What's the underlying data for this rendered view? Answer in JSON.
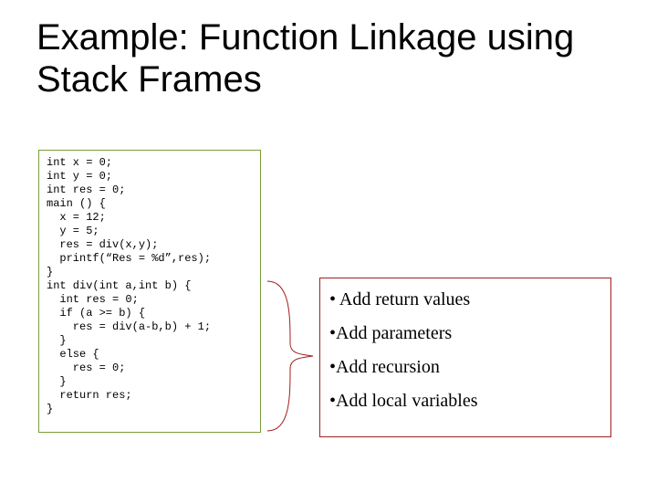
{
  "title": "Example: Function Linkage using Stack Frames",
  "code": "int x = 0;\nint y = 0;\nint res = 0;\nmain () {\n  x = 12;\n  y = 5;\n  res = div(x,y);\n  printf(“Res = %d”,res);\n}\nint div(int a,int b) {\n  int res = 0;\n  if (a >= b) {\n    res = div(a-b,b) + 1;\n  }\n  else {\n    res = 0;\n  }\n  return res;\n}",
  "bullets": {
    "b1": "• Add return values",
    "b2": "•Add parameters",
    "b3": "•Add recursion",
    "b4": "•Add local variables"
  }
}
